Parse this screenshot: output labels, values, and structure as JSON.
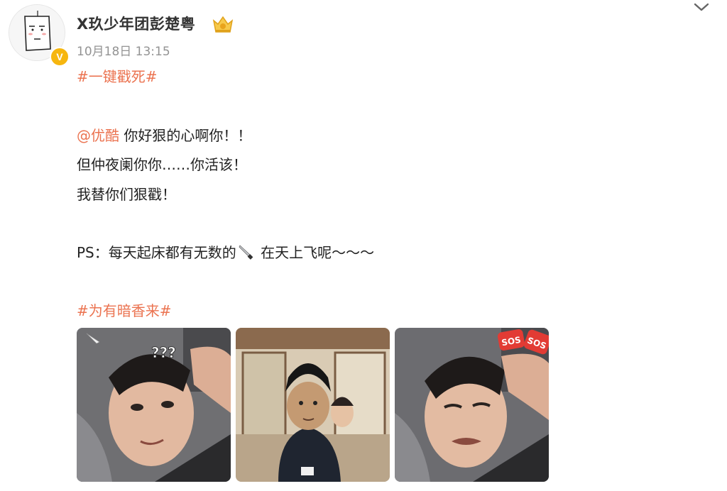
{
  "post": {
    "username": "X玖少年团彭楚粤",
    "timestamp": "10月18日 13:15",
    "hashtag_top": "#一键戳死#",
    "mention": "@优酷",
    "line1_rest": " 你好狠的心啊你！！",
    "line2": "但仲夜阑你你……你活该！",
    "line3": "我替你们狠戳！",
    "ps_prefix": "PS：每天起床都有无数的",
    "ps_suffix": " 在天上飞呢～～～",
    "hashtag_bottom": "#为有暗香来#"
  },
  "stickers": {
    "question_marks": "???",
    "sos": "SOS"
  },
  "icons": {
    "verified": "verified-v-icon",
    "crown": "member-crown-icon",
    "collapse": "chevron-down-icon",
    "knife": "knife-emoji"
  },
  "colors": {
    "link": "#eb7350",
    "timestamp": "#939393",
    "verified_badge": "#f6b60f"
  },
  "verified_letter": "V"
}
